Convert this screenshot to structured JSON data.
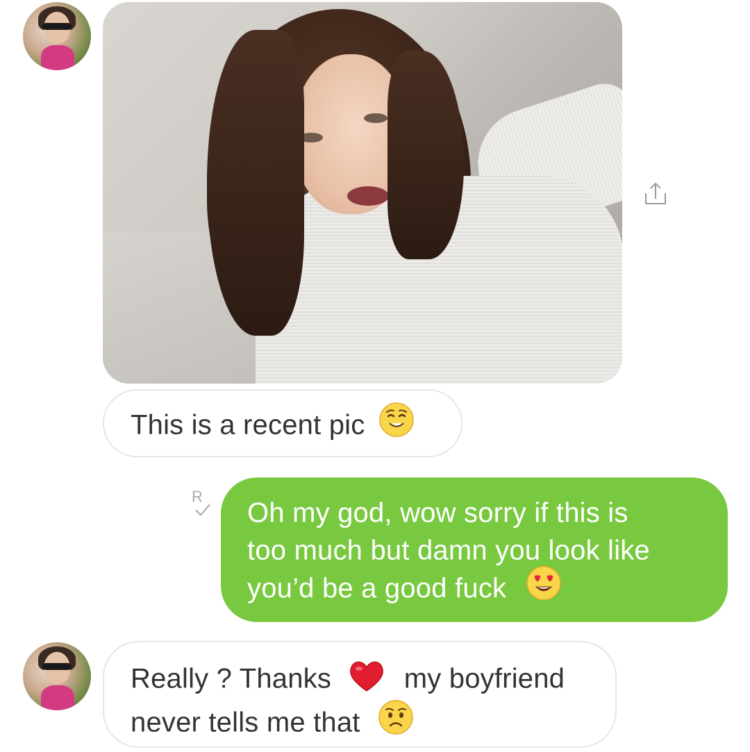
{
  "conversation": {
    "messages": [
      {
        "from": "them",
        "type": "photo"
      },
      {
        "from": "them",
        "type": "text",
        "line1": "This is a recent pic",
        "emoji": "relieved-face"
      },
      {
        "from": "me",
        "type": "text",
        "line1": "Oh my god, wow sorry if this is",
        "line2": "too much but damn you look like",
        "line3": "you’d be a good fuck",
        "emoji": "heart-eyes-face",
        "receipt": "R"
      },
      {
        "from": "them",
        "type": "text",
        "line1a": "Really ? Thanks",
        "emoji1": "red-heart",
        "line1b": "my boyfriend",
        "line2": "never tells me that",
        "emoji2": "worried-face"
      }
    ]
  },
  "icons": {
    "share": "share-icon",
    "read_receipt": "read-receipt-icon"
  },
  "colors": {
    "outgoing_bubble": "#78c93f",
    "incoming_bubble": "#ffffff",
    "incoming_border": "#e6e6e9",
    "incoming_text": "#333333",
    "outgoing_text": "#ffffff",
    "receipt": "#a9a9ad"
  }
}
